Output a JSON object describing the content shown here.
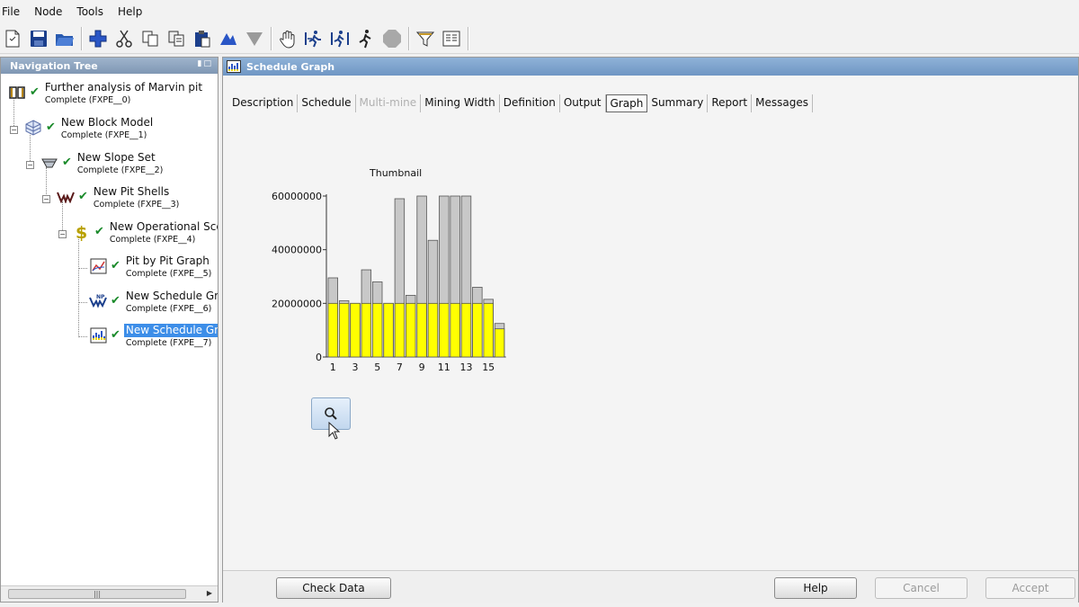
{
  "menu": [
    "File",
    "Node",
    "Tools",
    "Help"
  ],
  "toolbar_icons": [
    "new-file-icon",
    "save-icon",
    "open-folder-icon",
    "add-node-icon",
    "cut-icon",
    "copy-icon",
    "paste-icon",
    "clipboard-icon",
    "triangle-up-icon",
    "triangle-down-icon",
    "hand-icon",
    "run-forward-icon",
    "run-range-icon",
    "run-person-icon",
    "stop-icon",
    "funnel-icon",
    "notes-icon"
  ],
  "nav": {
    "title": "Navigation Tree",
    "nodes": [
      {
        "title": "Further analysis of Marvin pit",
        "status": "Complete (FXPE__0)",
        "icon": "book-icon"
      },
      {
        "title": "New Block Model",
        "status": "Complete (FXPE__1)",
        "icon": "block-model-icon"
      },
      {
        "title": "New Slope Set",
        "status": "Complete (FXPE__2)",
        "icon": "slope-icon"
      },
      {
        "title": "New Pit Shells",
        "status": "Complete (FXPE__3)",
        "icon": "pit-shell-icon"
      },
      {
        "title": "New Operational Scena",
        "status": "Complete (FXPE__4)",
        "icon": "dollar-icon"
      },
      {
        "title": "Pit by Pit Graph",
        "status": "Complete (FXPE__5)",
        "icon": "graph-icon"
      },
      {
        "title": "New Schedule Grap",
        "status": "Complete (FXPE__6)",
        "icon": "schedule-np-icon"
      },
      {
        "title": "New Schedule Grap",
        "status": "Complete (FXPE__7)",
        "icon": "schedule-graph-icon",
        "selected": true
      }
    ]
  },
  "main": {
    "title": "Schedule Graph",
    "tabs": [
      {
        "label": "Description"
      },
      {
        "label": "Schedule"
      },
      {
        "label": "Multi-mine",
        "disabled": true
      },
      {
        "label": "Mining Width"
      },
      {
        "label": "Definition"
      },
      {
        "label": "Output"
      },
      {
        "label": "Graph",
        "active": true
      },
      {
        "label": "Summary"
      },
      {
        "label": "Report"
      },
      {
        "label": "Messages"
      }
    ],
    "chart_title": "Thumbnail",
    "zoom_icon": "magnifier-icon"
  },
  "chart_data": {
    "type": "bar",
    "title": "Thumbnail",
    "categories": [
      1,
      2,
      3,
      4,
      5,
      6,
      7,
      8,
      9,
      10,
      11,
      12,
      13,
      14,
      15,
      16
    ],
    "x_tick_labels": [
      "1",
      "3",
      "5",
      "7",
      "9",
      "11",
      "13",
      "15"
    ],
    "y_tick_labels": [
      "0",
      "20000000",
      "40000000",
      "60000000"
    ],
    "ylim": [
      0,
      60000000
    ],
    "series": [
      {
        "color": "#ffff00",
        "values": [
          20000000,
          20000000,
          20000000,
          20000000,
          20000000,
          20000000,
          20000000,
          20000000,
          20000000,
          20000000,
          20000000,
          20000000,
          20000000,
          20000000,
          20000000,
          10500000
        ]
      },
      {
        "color": "#c8c8c8",
        "values": [
          29500000,
          21000000,
          20000000,
          32500000,
          28000000,
          20000000,
          59000000,
          23000000,
          60000000,
          43500000,
          60000000,
          60000000,
          60000000,
          26000000,
          21500000,
          12500000
        ]
      }
    ],
    "grid": false
  },
  "footer": {
    "check_data": "Check Data",
    "help": "Help",
    "cancel": "Cancel",
    "accept": "Accept"
  }
}
